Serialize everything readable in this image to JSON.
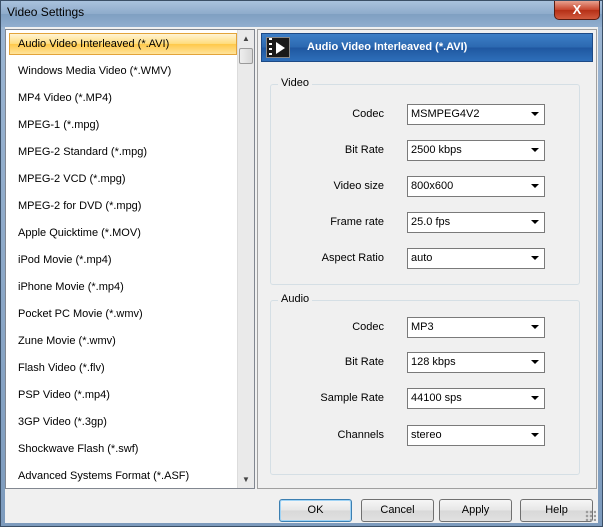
{
  "window": {
    "title": "Video Settings",
    "close_symbol": "X"
  },
  "formats": {
    "selected_index": 0,
    "items": [
      "Audio Video Interleaved (*.AVI)",
      "Windows Media Video (*.WMV)",
      "MP4 Video (*.MP4)",
      "MPEG-1 (*.mpg)",
      "MPEG-2 Standard (*.mpg)",
      "MPEG-2 VCD (*.mpg)",
      "MPEG-2 for DVD (*.mpg)",
      "Apple Quicktime (*.MOV)",
      "iPod Movie (*.mp4)",
      "iPhone Movie (*.mp4)",
      "Pocket PC Movie (*.wmv)",
      "Zune Movie (*.wmv)",
      "Flash Video (*.flv)",
      "PSP Video (*.mp4)",
      "3GP Video (*.3gp)",
      "Shockwave Flash (*.swf)",
      "Advanced Systems Format (*.ASF)"
    ]
  },
  "header": {
    "title": "Audio Video Interleaved (*.AVI)",
    "icon": "film-icon"
  },
  "video": {
    "label": "Video",
    "rows": [
      {
        "label": "Codec",
        "value": "MSMPEG4V2"
      },
      {
        "label": "Bit Rate",
        "value": "2500 kbps"
      },
      {
        "label": "Video size",
        "value": "800x600"
      },
      {
        "label": "Frame rate",
        "value": "25.0 fps"
      },
      {
        "label": "Aspect Ratio",
        "value": "auto"
      }
    ]
  },
  "audio": {
    "label": "Audio",
    "rows": [
      {
        "label": "Codec",
        "value": "MP3"
      },
      {
        "label": "Bit Rate",
        "value": "128 kbps"
      },
      {
        "label": "Sample Rate",
        "value": "44100 sps"
      },
      {
        "label": "Channels",
        "value": "stereo"
      }
    ]
  },
  "buttons": {
    "ok": "OK",
    "cancel": "Cancel",
    "apply": "Apply",
    "help": "Help"
  }
}
